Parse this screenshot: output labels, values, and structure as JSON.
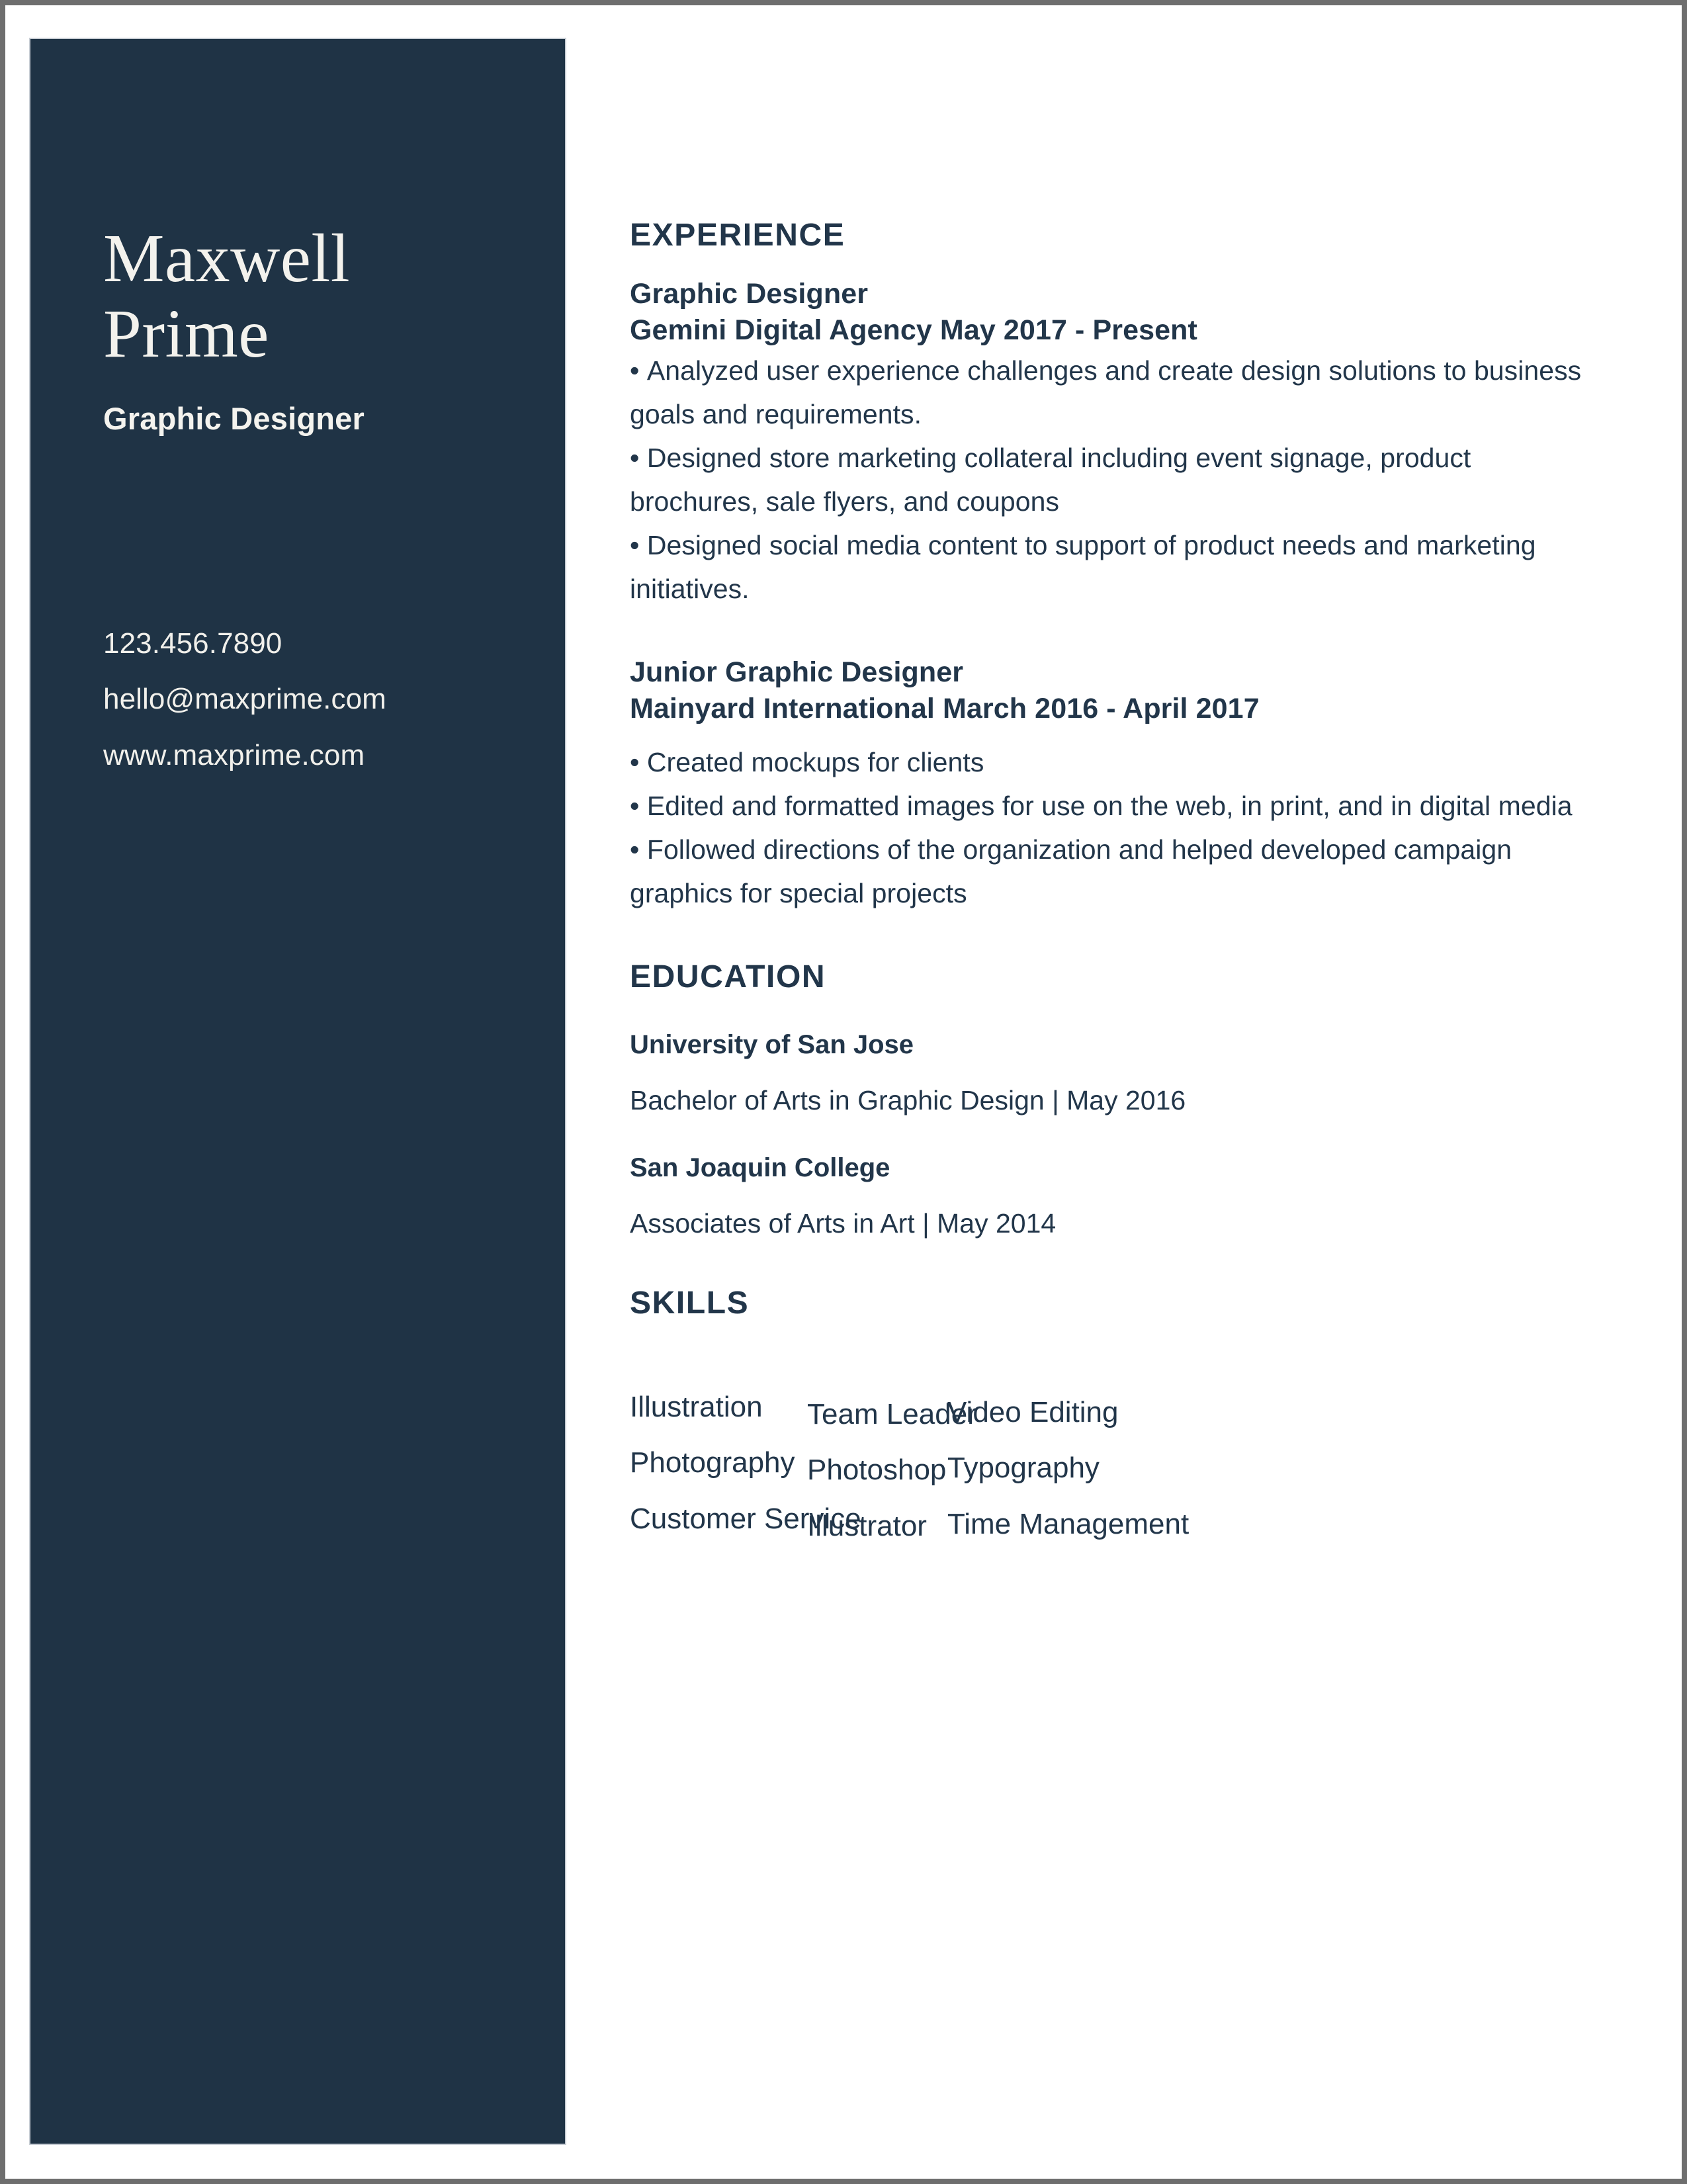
{
  "theme": {
    "sidebar_bg": "#1f3345",
    "sidebar_text": "#f3f2ed",
    "ink": "#22364a",
    "page_bg": "#ffffff",
    "canvas_bg": "#6e6e6e"
  },
  "sidebar": {
    "name_first": "Maxwell",
    "name_last": "Prime",
    "job_title": "Graphic Designer",
    "contact": {
      "phone": "123.456.7890",
      "email": "hello@maxprime.com",
      "website": "www.maxprime.com"
    }
  },
  "main": {
    "experience": {
      "heading": "EXPERIENCE",
      "jobs": [
        {
          "role": "Graphic Designer",
          "meta": "Gemini Digital Agency May 2017 - Present",
          "bullets": [
            "Analyzed user experience challenges and create design solutions to business goals and requirements.",
            "Designed store marketing collateral including event signage, product brochures, sale flyers, and coupons",
            "Designed social media content to support of product needs and marketing initiatives."
          ]
        },
        {
          "role": "Junior Graphic Designer",
          "meta": "Mainyard International March 2016 - April 2017",
          "bullets": [
            "Created mockups for clients",
            "Edited and formatted images for use on the web, in print, and in digital media",
            "Followed directions of the organization and helped developed campaign graphics for special projects"
          ]
        }
      ]
    },
    "education": {
      "heading": "EDUCATION",
      "entries": [
        {
          "school": "University of San Jose",
          "degree": "Bachelor of Arts in Graphic Design | May 2016"
        },
        {
          "school": "San Joaquin College",
          "degree": "Associates of Arts in Art | May 2014"
        }
      ]
    },
    "skills": {
      "heading": "SKILLS",
      "columns": [
        [
          "Illustration",
          "Photography",
          "Customer Service"
        ],
        [
          "Team Leader",
          "Photoshop",
          "Illustrator"
        ],
        [
          "Video Editing",
          "Typography",
          "Time Management"
        ]
      ]
    }
  }
}
